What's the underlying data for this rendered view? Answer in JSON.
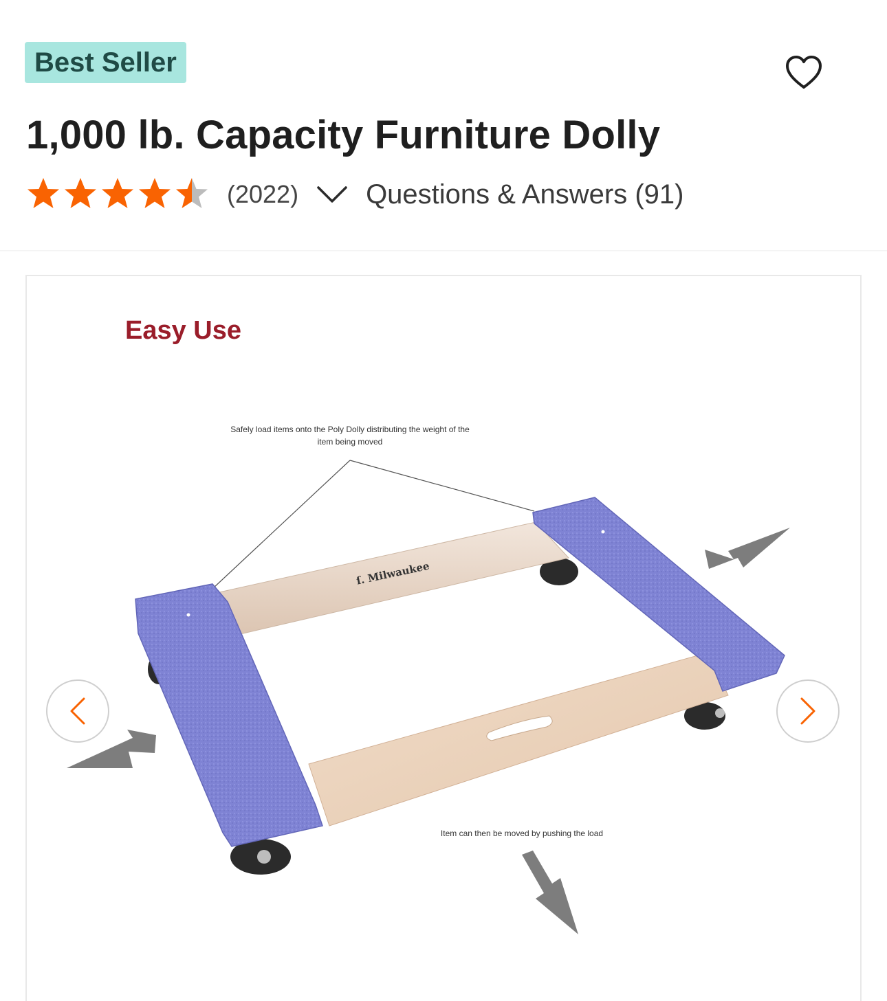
{
  "badge": {
    "label": "Best Seller"
  },
  "product": {
    "title": "1,000 lb. Capacity Furniture Dolly",
    "rating": 4.5,
    "rating_max": 5,
    "review_count": "(2022)",
    "qa_label": "Questions & Answers (91)"
  },
  "icons": {
    "favorite": "heart-outline-icon",
    "expand": "chevron-down-icon",
    "prev": "chevron-left-icon",
    "next": "chevron-right-icon",
    "star": "star-icon"
  },
  "colors": {
    "badge_bg": "#a8e6df",
    "badge_text": "#1f4a45",
    "star_filled": "#f96302",
    "star_empty": "#bcbcbc",
    "accent_orange": "#f96302",
    "image_heading": "#9a1d2a"
  },
  "gallery": {
    "heading": "Easy Use",
    "caption_top": "Safely load items onto the Poly Dolly distributing the weight of the item being moved",
    "caption_bottom": "Item can then be moved by pushing the load",
    "brand_mark": "Milwaukee"
  }
}
